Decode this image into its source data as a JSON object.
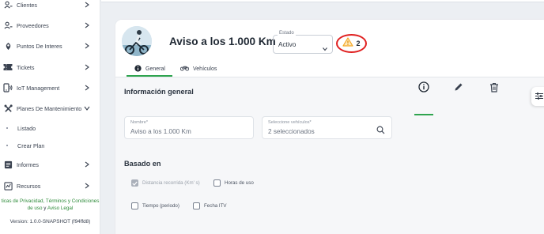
{
  "sidebar": {
    "items": [
      {
        "label": "Clientes",
        "icon": "users-icon"
      },
      {
        "label": "Proveedores",
        "icon": "users-icon"
      },
      {
        "label": "Puntos De Interes",
        "icon": "map-pin-icon"
      },
      {
        "label": "Tickets",
        "icon": "ticket-icon"
      },
      {
        "label": "IoT Management",
        "icon": "iot-icon"
      },
      {
        "label": "Planes De Mantenimiento",
        "icon": "tools-icon"
      },
      {
        "label": "Listado"
      },
      {
        "label": "Crear Plan"
      },
      {
        "label": "Informes",
        "icon": "report-icon"
      },
      {
        "label": "Recursos",
        "icon": "resources-icon"
      }
    ],
    "footer": {
      "line1_link": "ticas de Privacidad, Términos y Condiciones",
      "line2_link1": "de uso",
      "line2_connector": " y ",
      "line2_link2": "Aviso Legal"
    },
    "version": "Version: 1.0.0-SNAPSHOT (f94ffd8)"
  },
  "header": {
    "title": "Aviso a los 1.000 Km",
    "estado_label": "Estado",
    "estado_value": "Activo",
    "alert_count": "2",
    "tabs": [
      {
        "label": "General",
        "icon": "info-icon",
        "active": true
      },
      {
        "label": "Vehículos",
        "icon": "bicycle-icon",
        "active": false
      }
    ]
  },
  "info": {
    "section_title": "Información general",
    "nombre_label": "Nombre*",
    "nombre_value": "Aviso a los 1.000 Km",
    "vehiculos_label": "Seleccione vehículos*",
    "vehiculos_value": "2 seleccionados"
  },
  "basado": {
    "section_title": "Basado en",
    "options": [
      {
        "label": "Distancia recorrida (Km' s)",
        "checked": true
      },
      {
        "label": "Horas de uso",
        "checked": false
      },
      {
        "label": "Tiempo (periodo)",
        "checked": false
      },
      {
        "label": "Fecha ITV",
        "checked": false
      }
    ]
  },
  "colors": {
    "accent": "#2fa44f",
    "alert_ring": "#e01f1f",
    "warning": "#f5a623",
    "footer_link": "#2e8b3a"
  }
}
